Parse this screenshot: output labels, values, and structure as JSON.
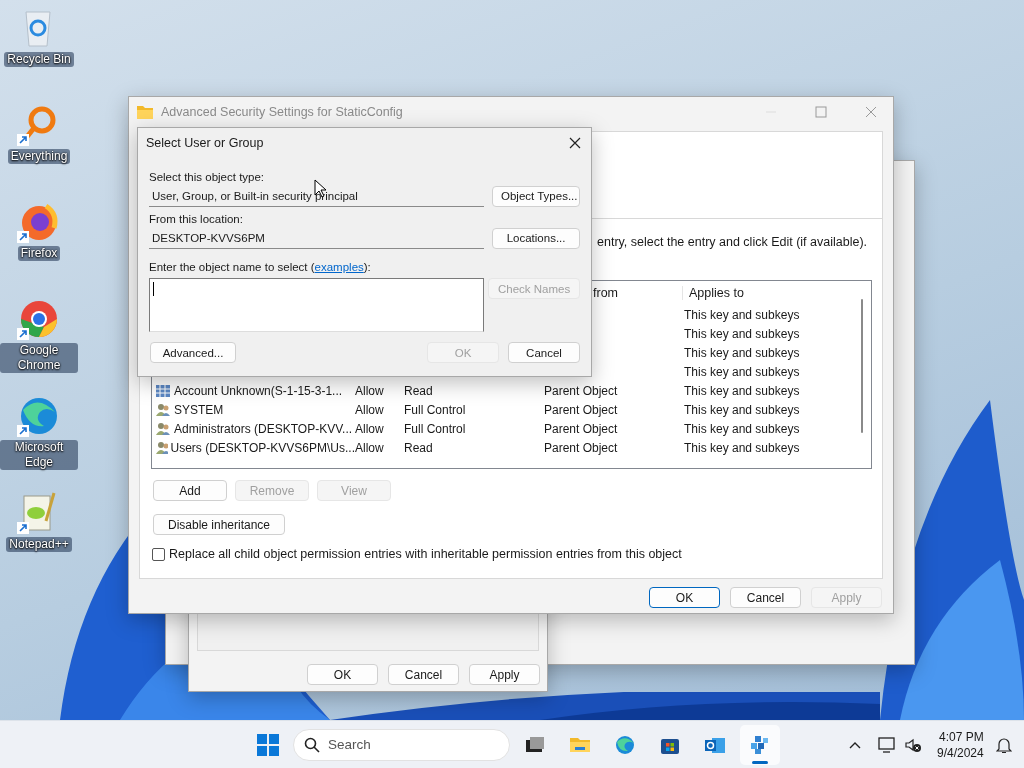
{
  "desktop_icons": [
    {
      "label": "Recycle Bin",
      "kind": "recycle",
      "shortcut": false
    },
    {
      "label": "Everything",
      "kind": "magnifier",
      "shortcut": true
    },
    {
      "label": "Firefox",
      "kind": "swirl",
      "shortcut": true
    },
    {
      "label": "Google Chrome",
      "kind": "ring",
      "shortcut": true
    },
    {
      "label": "Microsoft Edge",
      "kind": "wave",
      "shortcut": true
    },
    {
      "label": "Notepad++",
      "kind": "notepad",
      "shortcut": true
    }
  ],
  "properties_window": {
    "buttons": [
      {
        "label": "OK",
        "disabled": false
      },
      {
        "label": "Cancel",
        "disabled": false
      },
      {
        "label": "Apply",
        "disabled": false
      }
    ]
  },
  "advanced_window": {
    "title": "Advanced Security Settings for StaticConfig",
    "active": false,
    "instruction": "entry, select the entry and click Edit (if available).",
    "columns": [
      {
        "label": "from"
      },
      {
        "label": "Applies to"
      }
    ],
    "rows": [
      {
        "applies": "This key and subkeys"
      },
      {
        "applies": "This key and subkeys"
      },
      {
        "applies": "This key and subkeys"
      },
      {
        "applies": "This key and subkeys"
      },
      {
        "kind": "unknown",
        "principal": "Account Unknown(S-1-15-3-1...",
        "access": "Allow",
        "permission": "Read",
        "inherited": "Parent Object",
        "applies": "This key and subkeys"
      },
      {
        "kind": "group",
        "principal": "SYSTEM",
        "access": "Allow",
        "permission": "Full Control",
        "inherited": "Parent Object",
        "applies": "This key and subkeys"
      },
      {
        "kind": "group",
        "principal": "Administrators (DESKTOP-KVV...",
        "access": "Allow",
        "permission": "Full Control",
        "inherited": "Parent Object",
        "applies": "This key and subkeys"
      },
      {
        "kind": "group",
        "principal": "Users (DESKTOP-KVVS6PM\\Us...",
        "access": "Allow",
        "permission": "Read",
        "inherited": "Parent Object",
        "applies": "This key and subkeys"
      }
    ],
    "entry_buttons": [
      {
        "label": "Add",
        "disabled": false
      },
      {
        "label": "Remove",
        "disabled": true
      },
      {
        "label": "View",
        "disabled": true
      }
    ],
    "inheritance_button": {
      "label": "Disable inheritance",
      "disabled": false
    },
    "replace_checkbox": {
      "label": "Replace all child object permission entries with inheritable permission entries from this object",
      "checked": false
    },
    "footer_buttons": [
      {
        "label": "OK",
        "default": true,
        "disabled": false
      },
      {
        "label": "Cancel",
        "default": false,
        "disabled": false
      },
      {
        "label": "Apply",
        "default": false,
        "disabled": true
      }
    ]
  },
  "dialog": {
    "title": "Select User or Group",
    "object_type": {
      "label": "Select this object type:",
      "value": "User, Group, or Built-in security principal",
      "button": "Object Types..."
    },
    "location": {
      "label": "From this location:",
      "value": "DESKTOP-KVVS6PM",
      "button": "Locations..."
    },
    "object_name": {
      "label_before": "Enter the object name to select (",
      "link": "examples",
      "label_after": "):",
      "button": {
        "label": "Check Names",
        "disabled": true
      }
    },
    "buttons": [
      {
        "label": "Advanced...",
        "disabled": false
      },
      {
        "label": "OK",
        "disabled": true
      },
      {
        "label": "Cancel",
        "disabled": false
      }
    ]
  },
  "taskbar": {
    "search": {
      "placeholder": "Search"
    },
    "apps": [
      {
        "kind": "taskview",
        "active": false
      },
      {
        "kind": "folder",
        "active": false
      },
      {
        "kind": "browser",
        "active": false
      },
      {
        "kind": "store",
        "active": false
      },
      {
        "kind": "mail",
        "active": false
      },
      {
        "kind": "cubes",
        "active": true
      }
    ],
    "time": "4:07 PM",
    "date": "9/4/2024"
  }
}
